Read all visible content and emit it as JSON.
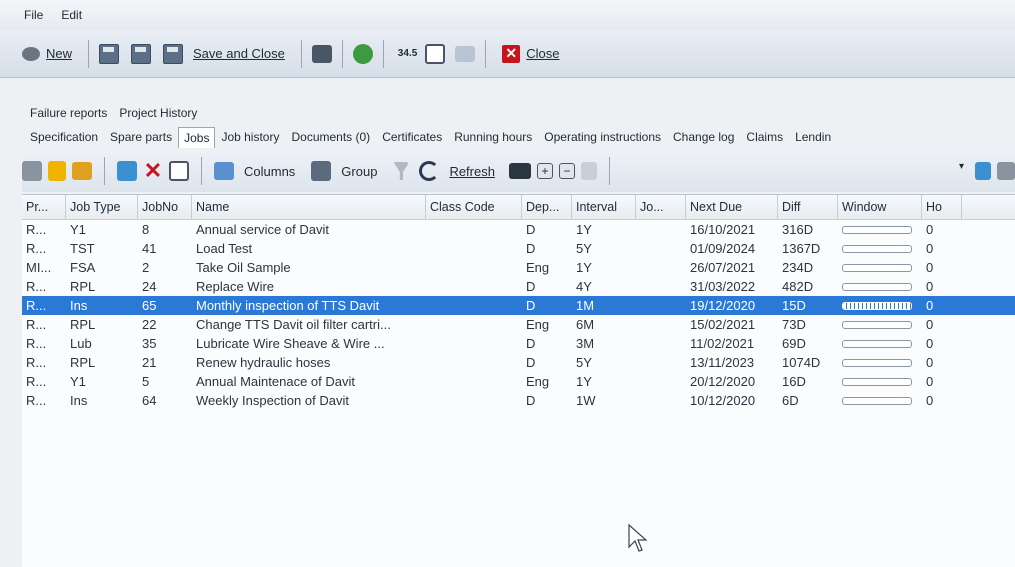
{
  "menu": {
    "file": "File",
    "edit": "Edit"
  },
  "toolbar": {
    "new_label": "New",
    "save_close_label": "Save and Close",
    "value_label": "34.5",
    "close_label": "Close"
  },
  "tabs_top": [
    "Failure reports",
    "Project History"
  ],
  "tabs_main": [
    "Specification",
    "Spare parts",
    "Jobs",
    "Job history",
    "Documents (0)",
    "Certificates",
    "Running hours",
    "Operating instructions",
    "Change log",
    "Claims",
    "Lendin"
  ],
  "active_tab": "Jobs",
  "grid_toolbar": {
    "columns_label": "Columns",
    "group_label": "Group",
    "refresh_label": "Refresh"
  },
  "columns": [
    "Pr...",
    "Job Type",
    "JobNo",
    "Name",
    "Class Code",
    "Dep...",
    "Interval",
    "Jo...",
    "Next Due",
    "Diff",
    "Window",
    "Ho"
  ],
  "rows": [
    {
      "pr": "R...",
      "type": "Y1",
      "no": "8",
      "name": "Annual service of Davit",
      "cls": "",
      "dep": "D",
      "interval": "1Y",
      "jo": "",
      "due": "16/10/2021",
      "diff": "316D",
      "window": 0,
      "ho": "0"
    },
    {
      "pr": "R...",
      "type": "TST",
      "no": "41",
      "name": "Load Test",
      "cls": "",
      "dep": "D",
      "interval": "5Y",
      "jo": "",
      "due": "01/09/2024",
      "diff": "1367D",
      "window": 0,
      "ho": "0"
    },
    {
      "pr": "MI...",
      "type": "FSA",
      "no": "2",
      "name": "Take Oil Sample",
      "cls": "",
      "dep": "Eng",
      "interval": "1Y",
      "jo": "",
      "due": "26/07/2021",
      "diff": "234D",
      "window": 0,
      "ho": "0"
    },
    {
      "pr": "R...",
      "type": "RPL",
      "no": "24",
      "name": "Replace Wire",
      "cls": "",
      "dep": "D",
      "interval": "4Y",
      "jo": "",
      "due": "31/03/2022",
      "diff": "482D",
      "window": 0,
      "ho": "0"
    },
    {
      "pr": "R...",
      "type": "Ins",
      "no": "65",
      "name": "Monthly inspection of TTS Davit",
      "cls": "",
      "dep": "D",
      "interval": "1M",
      "jo": "",
      "due": "19/12/2020",
      "diff": "15D",
      "window": 1,
      "ho": "0",
      "selected": true
    },
    {
      "pr": "R...",
      "type": "RPL",
      "no": "22",
      "name": "Change TTS Davit oil filter cartri...",
      "cls": "",
      "dep": "Eng",
      "interval": "6M",
      "jo": "",
      "due": "15/02/2021",
      "diff": "73D",
      "window": 0,
      "ho": "0"
    },
    {
      "pr": "R...",
      "type": "Lub",
      "no": "35",
      "name": "Lubricate Wire Sheave & Wire ...",
      "cls": "",
      "dep": "D",
      "interval": "3M",
      "jo": "",
      "due": "11/02/2021",
      "diff": "69D",
      "window": 0,
      "ho": "0"
    },
    {
      "pr": "R...",
      "type": "RPL",
      "no": "21",
      "name": "Renew hydraulic hoses",
      "cls": "",
      "dep": "D",
      "interval": "5Y",
      "jo": "",
      "due": "13/11/2023",
      "diff": "1074D",
      "window": 0,
      "ho": "0"
    },
    {
      "pr": "R...",
      "type": "Y1",
      "no": "5",
      "name": "Annual Maintenace of Davit",
      "cls": "",
      "dep": "Eng",
      "interval": "1Y",
      "jo": "",
      "due": "20/12/2020",
      "diff": "16D",
      "window": 0,
      "ho": "0"
    },
    {
      "pr": "R...",
      "type": "Ins",
      "no": "64",
      "name": "Weekly Inspection of Davit",
      "cls": "",
      "dep": "D",
      "interval": "1W",
      "jo": "",
      "due": "10/12/2020",
      "diff": "6D",
      "window": 0,
      "ho": "0"
    }
  ]
}
